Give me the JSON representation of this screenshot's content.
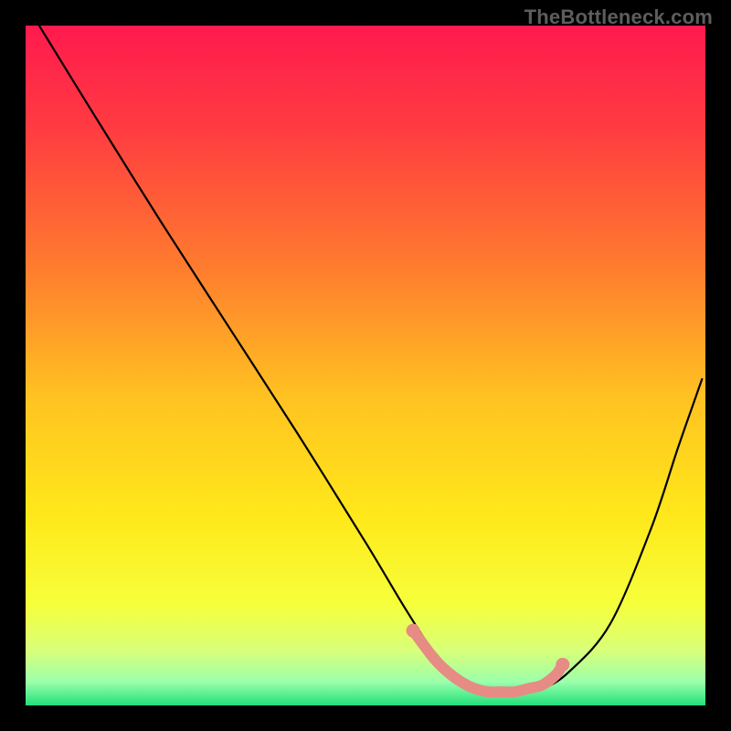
{
  "watermark": "TheBottleneck.com",
  "chart_data": {
    "type": "line",
    "title": "",
    "xlabel": "",
    "ylabel": "",
    "xlim": [
      0,
      100
    ],
    "ylim": [
      0,
      100
    ],
    "gradient_stops": [
      {
        "pos": 0.0,
        "color": "#ff1a4e"
      },
      {
        "pos": 0.15,
        "color": "#ff3b41"
      },
      {
        "pos": 0.35,
        "color": "#ff7a2f"
      },
      {
        "pos": 0.55,
        "color": "#ffc321"
      },
      {
        "pos": 0.72,
        "color": "#ffe81a"
      },
      {
        "pos": 0.85,
        "color": "#f6ff3a"
      },
      {
        "pos": 0.92,
        "color": "#d8ff7a"
      },
      {
        "pos": 0.965,
        "color": "#9cffab"
      },
      {
        "pos": 1.0,
        "color": "#22e07a"
      }
    ],
    "series": [
      {
        "name": "bottleneck-curve",
        "x": [
          2,
          10,
          20,
          30,
          40,
          50,
          56,
          60,
          64,
          68,
          72,
          76,
          80,
          86,
          92,
          96,
          99.5
        ],
        "values": [
          100,
          87,
          71,
          55.5,
          40,
          24,
          14,
          8,
          4,
          2,
          2,
          2.5,
          5,
          12,
          26,
          38,
          48
        ]
      }
    ],
    "highlight": {
      "name": "optimal-range",
      "color": "#e78b85",
      "x": [
        57,
        60,
        62,
        64,
        66,
        68,
        70,
        72,
        74,
        76,
        78,
        79
      ],
      "values": [
        11,
        7,
        5,
        3.5,
        2.5,
        2,
        2,
        2,
        2.5,
        3,
        4.5,
        6
      ]
    }
  }
}
